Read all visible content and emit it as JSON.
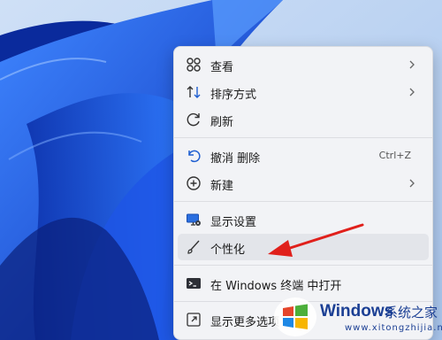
{
  "menu": {
    "items": [
      {
        "label": "查看",
        "icon": "grid-view-icon",
        "submenu": true
      },
      {
        "label": "排序方式",
        "icon": "sort-arrows-icon",
        "submenu": true
      },
      {
        "label": "刷新",
        "icon": "refresh-icon",
        "submenu": false
      },
      {
        "label": "撤消 删除",
        "icon": "undo-icon",
        "shortcut": "Ctrl+Z",
        "submenu": false
      },
      {
        "label": "新建",
        "icon": "add-circle-icon",
        "submenu": true
      },
      {
        "label": "显示设置",
        "icon": "display-settings-icon",
        "submenu": false
      },
      {
        "label": "个性化",
        "icon": "brush-icon",
        "submenu": false,
        "highlighted": true
      },
      {
        "label": "在 Windows 终端 中打开",
        "icon": "terminal-icon",
        "submenu": false
      },
      {
        "label": "显示更多选项",
        "icon": "open-more-icon",
        "submenu": false
      }
    ]
  },
  "watermark": {
    "title": "Windows",
    "subtitle": "系统之家",
    "url": "www.xitongzhijia.net"
  },
  "colors": {
    "menu_bg": "#f2f3f6",
    "accent_blue": "#1f5fd1",
    "arrow_red": "#e0201b",
    "watermark_blue": "#1b3f94"
  }
}
